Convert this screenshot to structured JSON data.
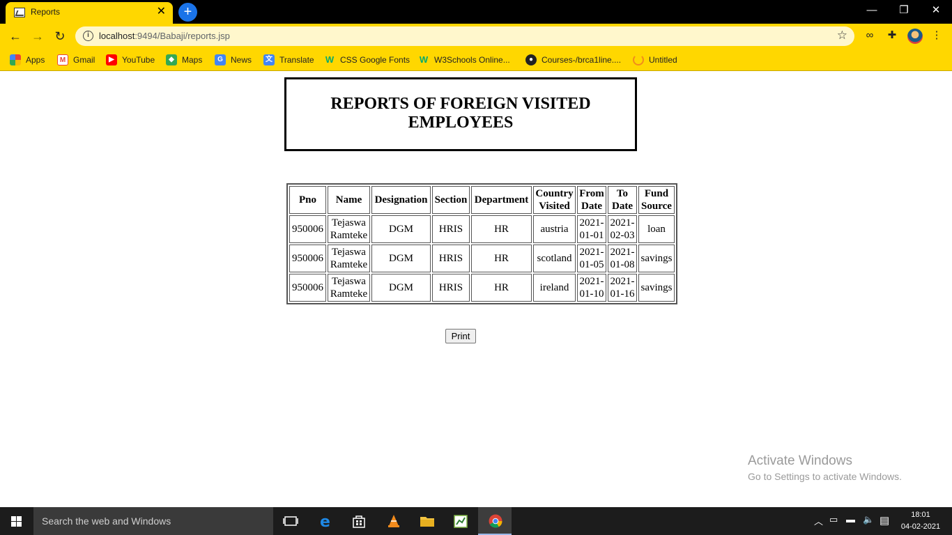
{
  "browser": {
    "tab_title": "Reports",
    "url_host": "localhost",
    "url_rest": ":9494/Babaji/reports.jsp",
    "bookmarks": [
      {
        "label": "Apps",
        "icon": "apps-grid-icon"
      },
      {
        "label": "Gmail",
        "icon": "gmail-icon"
      },
      {
        "label": "YouTube",
        "icon": "youtube-icon"
      },
      {
        "label": "Maps",
        "icon": "maps-icon"
      },
      {
        "label": "News",
        "icon": "news-icon"
      },
      {
        "label": "Translate",
        "icon": "translate-icon"
      },
      {
        "label": "CSS Google Fonts",
        "icon": "w3schools-icon"
      },
      {
        "label": "W3Schools Online...",
        "icon": "w3schools-icon"
      },
      {
        "label": "Courses-/brca1line....",
        "icon": "github-icon"
      },
      {
        "label": "Untitled",
        "icon": "loading-icon"
      }
    ]
  },
  "page": {
    "title": "REPORTS OF FOREIGN VISITED EMPLOYEES",
    "table": {
      "headers": [
        "Pno",
        "Name",
        "Designation",
        "Section",
        "Department",
        "Country Visited",
        "From Date",
        "To Date",
        "Fund Source"
      ],
      "rows": [
        [
          "950006",
          "Tejaswa Ramteke",
          "DGM",
          "HRIS",
          "HR",
          "austria",
          "2021-01-01",
          "2021-02-03",
          "loan"
        ],
        [
          "950006",
          "Tejaswa Ramteke",
          "DGM",
          "HRIS",
          "HR",
          "scotland",
          "2021-01-05",
          "2021-01-08",
          "savings"
        ],
        [
          "950006",
          "Tejaswa Ramteke",
          "DGM",
          "HRIS",
          "HR",
          "ireland",
          "2021-01-10",
          "2021-01-16",
          "savings"
        ]
      ]
    },
    "print_label": "Print"
  },
  "watermark": {
    "line1": "Activate Windows",
    "line2": "Go to Settings to activate Windows."
  },
  "taskbar": {
    "search_placeholder": "Search the web and Windows",
    "time": "18:01",
    "date": "04-02-2021"
  },
  "colors": {
    "chrome_theme": "#ffd700",
    "titlebar": "#000000",
    "taskbar": "#1c1c1c"
  }
}
